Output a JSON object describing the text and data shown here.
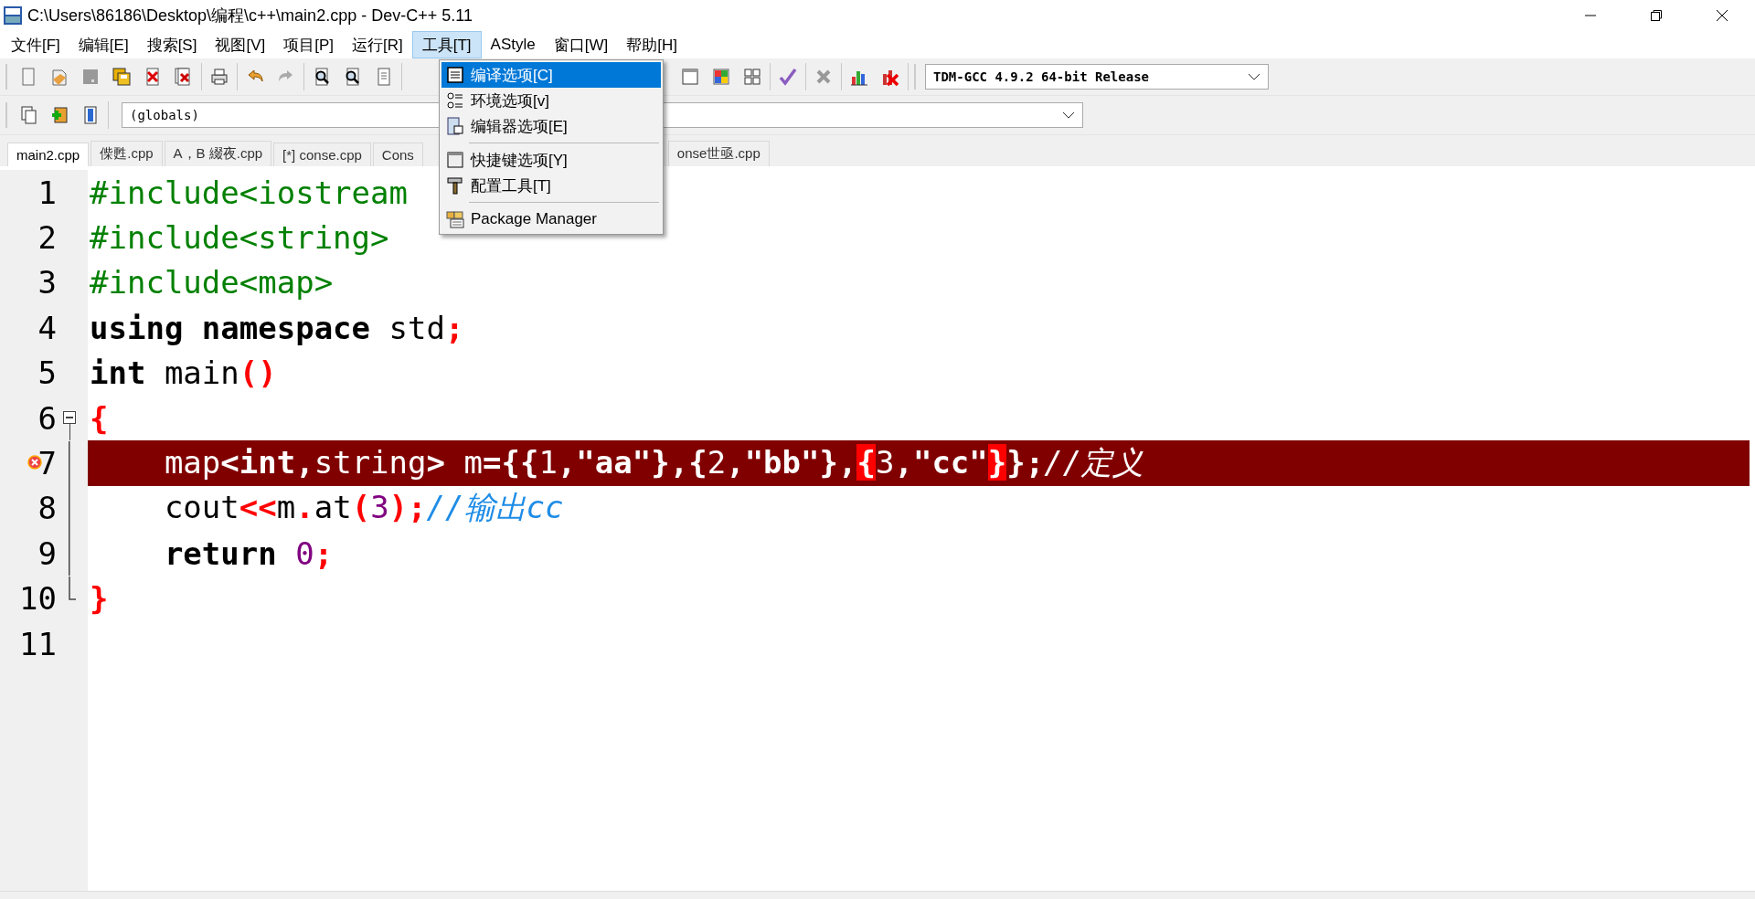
{
  "window": {
    "title": "C:\\Users\\86186\\Desktop\\编程\\c++\\main2.cpp - Dev-C++ 5.11"
  },
  "menu_bar": [
    {
      "label": "文件[F]",
      "selected": false
    },
    {
      "label": "编辑[E]",
      "selected": false
    },
    {
      "label": "搜索[S]",
      "selected": false
    },
    {
      "label": "视图[V]",
      "selected": false
    },
    {
      "label": "项目[P]",
      "selected": false
    },
    {
      "label": "运行[R]",
      "selected": false
    },
    {
      "label": "工具[T]",
      "selected": true
    },
    {
      "label": "AStyle",
      "selected": false
    },
    {
      "label": "窗口[W]",
      "selected": false
    },
    {
      "label": "帮助[H]",
      "selected": false
    }
  ],
  "compiler_select": {
    "value": "TDM-GCC 4.9.2 64-bit Release"
  },
  "scope_select": {
    "value": "(globals)"
  },
  "tabs": [
    {
      "label": "main2.cpp",
      "selected": true
    },
    {
      "label": "偨甦.cpp",
      "selected": false
    },
    {
      "label": "A，B 綴夜.cpp",
      "selected": false
    },
    {
      "label": "[*] conse.cpp",
      "selected": false
    },
    {
      "label": "Cons",
      "selected": false
    },
    {
      "label": "onse世亟.cpp",
      "selected": false
    }
  ],
  "tools_menu": [
    {
      "kind": "item",
      "label": "编译选项[C]",
      "selected": true
    },
    {
      "kind": "item",
      "label": "环境选项[v]",
      "selected": false
    },
    {
      "kind": "item",
      "label": "编辑器选项[E]",
      "selected": false
    },
    {
      "kind": "separator"
    },
    {
      "kind": "item",
      "label": "快捷键选项[Y]",
      "selected": false
    },
    {
      "kind": "item",
      "label": "配置工具[T]",
      "selected": false
    },
    {
      "kind": "separator"
    },
    {
      "kind": "item",
      "label": "Package Manager",
      "selected": false
    }
  ],
  "editor": {
    "lines": [
      {
        "number": "1",
        "error": false,
        "kind": "plain",
        "tokens": [
          {
            "kind": "pre",
            "text": "#include<iostream"
          }
        ]
      },
      {
        "number": "2",
        "error": false,
        "kind": "plain",
        "tokens": [
          {
            "kind": "pre",
            "text": "#include<string>"
          }
        ]
      },
      {
        "number": "3",
        "error": false,
        "kind": "plain",
        "tokens": [
          {
            "kind": "pre",
            "text": "#include<map>"
          }
        ]
      },
      {
        "number": "4",
        "error": false,
        "kind": "plain",
        "tokens": [
          {
            "kind": "kw",
            "text": "using namespace"
          },
          {
            "kind": "plain",
            "text": " std"
          },
          {
            "kind": "sym",
            "text": ";"
          }
        ]
      },
      {
        "number": "5",
        "error": false,
        "kind": "plain",
        "tokens": [
          {
            "kind": "kw",
            "text": "int"
          },
          {
            "kind": "plain",
            "text": " main"
          },
          {
            "kind": "sym",
            "text": "()"
          }
        ]
      },
      {
        "number": "6",
        "error": false,
        "kind": "fold-start",
        "tokens": [
          {
            "kind": "sym",
            "text": "{"
          }
        ]
      },
      {
        "number": "7",
        "error": true,
        "kind": "fold-body",
        "tokens": [
          {
            "kind": "plain",
            "text": "    map"
          },
          {
            "kind": "sym",
            "text": "<"
          },
          {
            "kind": "kw",
            "text": "int"
          },
          {
            "kind": "sym",
            "text": ","
          },
          {
            "kind": "plain",
            "text": "string"
          },
          {
            "kind": "sym",
            "text": ">"
          },
          {
            "kind": "plain",
            "text": " m"
          },
          {
            "kind": "sym",
            "text": "={{"
          },
          {
            "kind": "num",
            "text": "1"
          },
          {
            "kind": "sym",
            "text": ","
          },
          {
            "kind": "str",
            "text": "\"aa\""
          },
          {
            "kind": "sym",
            "text": "},{"
          },
          {
            "kind": "num",
            "text": "2"
          },
          {
            "kind": "sym",
            "text": ","
          },
          {
            "kind": "str",
            "text": "\"bb\""
          },
          {
            "kind": "sym",
            "text": "},"
          },
          {
            "kind": "match",
            "text": "{"
          },
          {
            "kind": "num",
            "text": "3"
          },
          {
            "kind": "sym",
            "text": ","
          },
          {
            "kind": "str",
            "text": "\"cc\""
          },
          {
            "kind": "match",
            "text": "}"
          },
          {
            "kind": "sym",
            "text": "};"
          },
          {
            "kind": "cmt",
            "text": "//定义"
          }
        ]
      },
      {
        "number": "8",
        "error": false,
        "kind": "fold-body",
        "tokens": [
          {
            "kind": "plain",
            "text": "    cout"
          },
          {
            "kind": "sym",
            "text": "<<"
          },
          {
            "kind": "plain",
            "text": "m"
          },
          {
            "kind": "sym",
            "text": "."
          },
          {
            "kind": "plain",
            "text": "at"
          },
          {
            "kind": "sym",
            "text": "("
          },
          {
            "kind": "num",
            "text": "3"
          },
          {
            "kind": "sym",
            "text": ");"
          },
          {
            "kind": "cmt",
            "text": "//输出cc"
          }
        ]
      },
      {
        "number": "9",
        "error": false,
        "kind": "fold-body",
        "tokens": [
          {
            "kind": "kw",
            "text": "    return "
          },
          {
            "kind": "num",
            "text": "0"
          },
          {
            "kind": "sym",
            "text": ";"
          }
        ]
      },
      {
        "number": "10",
        "error": false,
        "kind": "fold-end",
        "tokens": [
          {
            "kind": "sym",
            "text": "}"
          }
        ]
      },
      {
        "number": "11",
        "error": false,
        "kind": "plain"
      }
    ]
  }
}
